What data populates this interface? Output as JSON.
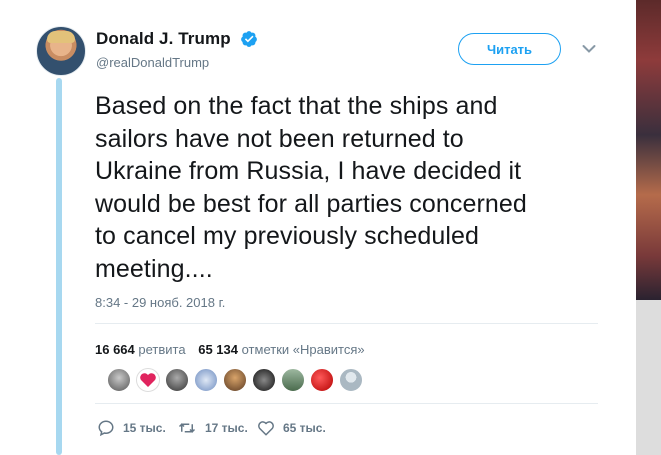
{
  "tweet": {
    "author_name": "Donald J. Trump",
    "author_handle": "@realDonaldTrump",
    "follow_label": "Читать",
    "text_lines": [
      "Based on the fact that the ships and",
      "sailors have not been returned to",
      "Ukraine from Russia, I have decided it",
      "would be best for all parties concerned",
      "to cancel my previously scheduled",
      "meeting...."
    ],
    "timestamp": "8:34 - 29 нояб. 2018 г.",
    "stats": {
      "retweets_count": "16 664",
      "retweets_label": "ретвита",
      "likes_count": "65 134",
      "likes_label": "отметки «Нравится»"
    },
    "actions": {
      "replies": "15 тыс.",
      "retweets": "17 тыс.",
      "likes": "65 тыс."
    }
  },
  "colors": {
    "accent": "#1da1f2",
    "thread_line": "#a7d8f0",
    "muted_text": "#657786"
  },
  "icons": [
    "verified-badge-icon",
    "chevron-down-icon",
    "reply-icon",
    "retweet-icon",
    "like-icon"
  ]
}
